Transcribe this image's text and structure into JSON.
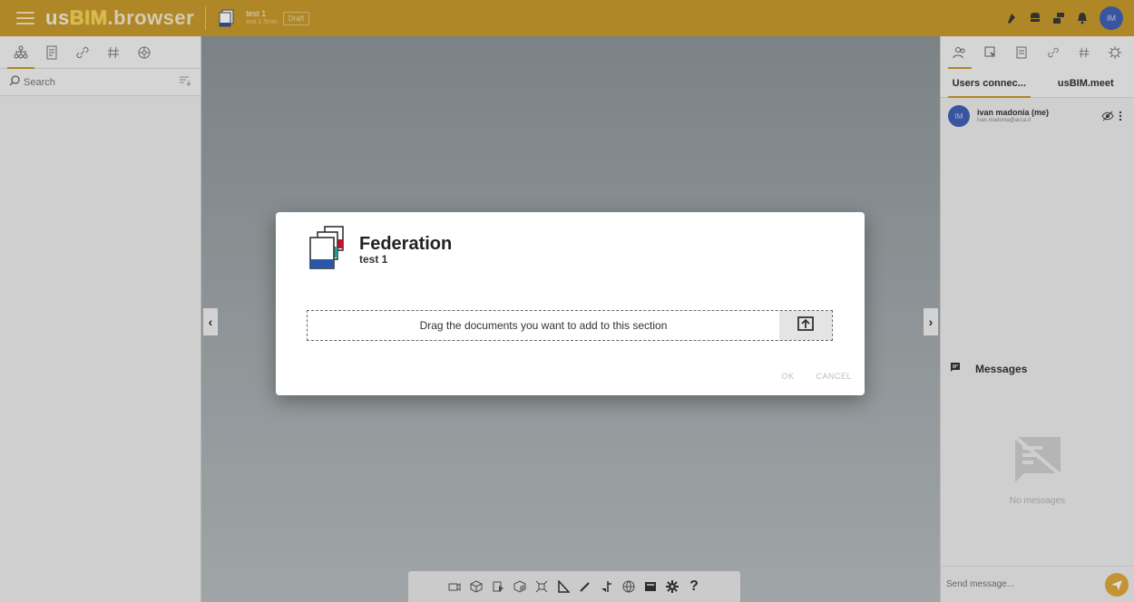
{
  "topbar": {
    "logo_part1": "us",
    "logo_part2": "BIM",
    "logo_part3": ".browser",
    "project_name": "test 1",
    "project_sub": "test 1 5mm",
    "draft_badge": "Draft",
    "user_initials": "IM",
    "icons": [
      "paint-icon",
      "database-icon",
      "layers-icon",
      "bell-icon"
    ]
  },
  "left_panel": {
    "tabs": [
      "hierarchy-icon",
      "document-icon",
      "link-icon",
      "hash-icon",
      "filter-icon"
    ],
    "search_placeholder": "Search"
  },
  "right_panel": {
    "tabs": [
      "users-icon",
      "cursor-icon",
      "document-icon",
      "link-icon",
      "hash-icon",
      "settings-icon"
    ],
    "subtabs": [
      "Users connec...",
      "usBIM.meet"
    ],
    "user": {
      "initials": "IM",
      "name": "ivan madonia (me)",
      "email": "ivan.madonia@acca.it"
    },
    "messages_title": "Messages",
    "no_messages": "No messages",
    "send_placeholder": "Send message..."
  },
  "dialog": {
    "title": "Federation",
    "subtitle": "test 1",
    "drop_text": "Drag the documents you want to add to this section",
    "ok_label": "OK",
    "cancel_label": "CANCEL"
  },
  "bottom_toolbar": {
    "icons": [
      "camera-icon",
      "cube-icon",
      "section-icon",
      "box-icon",
      "explode-icon",
      "measure-icon",
      "pen-icon",
      "annotate-icon",
      "globe-icon",
      "screenshot-icon",
      "gear-icon",
      "help-icon"
    ],
    "help_label": "?"
  },
  "colors": {
    "brand": "#c89a2c",
    "accent_blue": "#3f62b6",
    "send_orange": "#e0a83b"
  }
}
